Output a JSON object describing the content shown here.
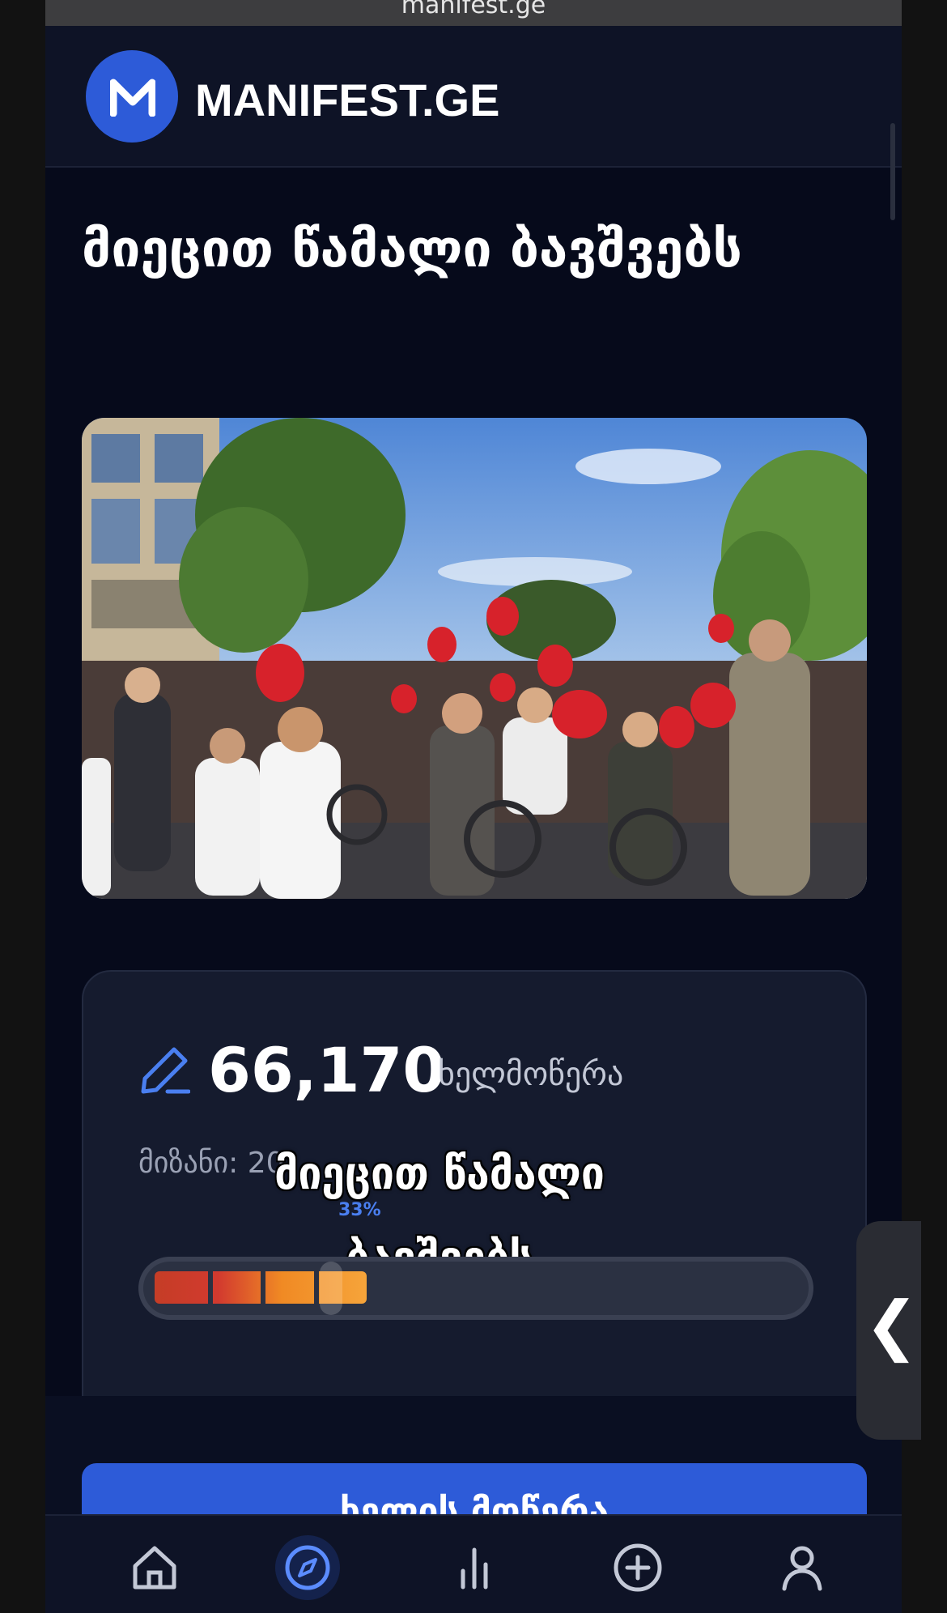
{
  "browser": {
    "url": "manifest.ge"
  },
  "header": {
    "logo_text": "MANIFEST.GE"
  },
  "petition": {
    "title": "მიეცით წამალი ბავშვებს",
    "signature_count": "66,170",
    "signature_label": "ხელმოწერა",
    "goal_label": "მიზანი: 20",
    "progress_percent_label": "33%",
    "progress_fraction": 0.33
  },
  "video_caption": "მიეცით წამალი ბავშვებს",
  "sign_button": {
    "label": "ხელის მოწერა"
  },
  "side_tab": {
    "icon": "chevron-left-icon",
    "glyph": "❮"
  },
  "nav": [
    {
      "name": "home",
      "icon": "home-icon"
    },
    {
      "name": "discover",
      "icon": "compass-icon",
      "active": true
    },
    {
      "name": "stats",
      "icon": "bar-chart-icon"
    },
    {
      "name": "create",
      "icon": "plus-circle-icon"
    },
    {
      "name": "profile",
      "icon": "user-icon"
    }
  ],
  "colors": {
    "accent": "#2d5bd8",
    "background": "#060a1b",
    "card": "#151b2e",
    "progress_start": "#c53d26",
    "progress_end": "#f6a43a"
  }
}
